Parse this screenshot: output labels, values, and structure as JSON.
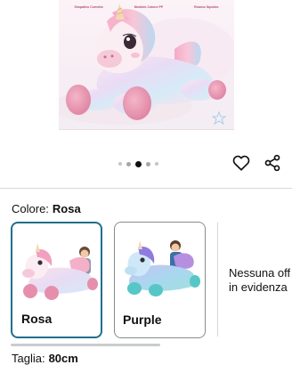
{
  "gallery": {
    "features": [
      "Simpatico Cornetto",
      "Morbido Cotone PP",
      "Ricamo Squisito"
    ],
    "dots": [
      {
        "state": "small"
      },
      {
        "state": "normal"
      },
      {
        "state": "active"
      },
      {
        "state": "normal"
      },
      {
        "state": "small"
      }
    ],
    "colors": {
      "body": "#f7e6ef",
      "hoof": "#e58fac",
      "mane_pink": "#f4a7c2",
      "mane_blue": "#a9d3ef",
      "horn": "#f1d9b0"
    }
  },
  "actions": {
    "favorite_icon": "heart-outline-icon",
    "share_icon": "share-icon"
  },
  "variation": {
    "color_label": "Colore:",
    "color_value": "Rosa",
    "options": [
      {
        "name": "Rosa",
        "selected": true
      },
      {
        "name": "Purple",
        "selected": false
      }
    ],
    "no_offer_line1": "Nessuna off",
    "no_offer_line2": "in evidenza",
    "selected_border_color": "#1f6f8b"
  },
  "size": {
    "label": "Taglia:",
    "value": "80cm"
  }
}
